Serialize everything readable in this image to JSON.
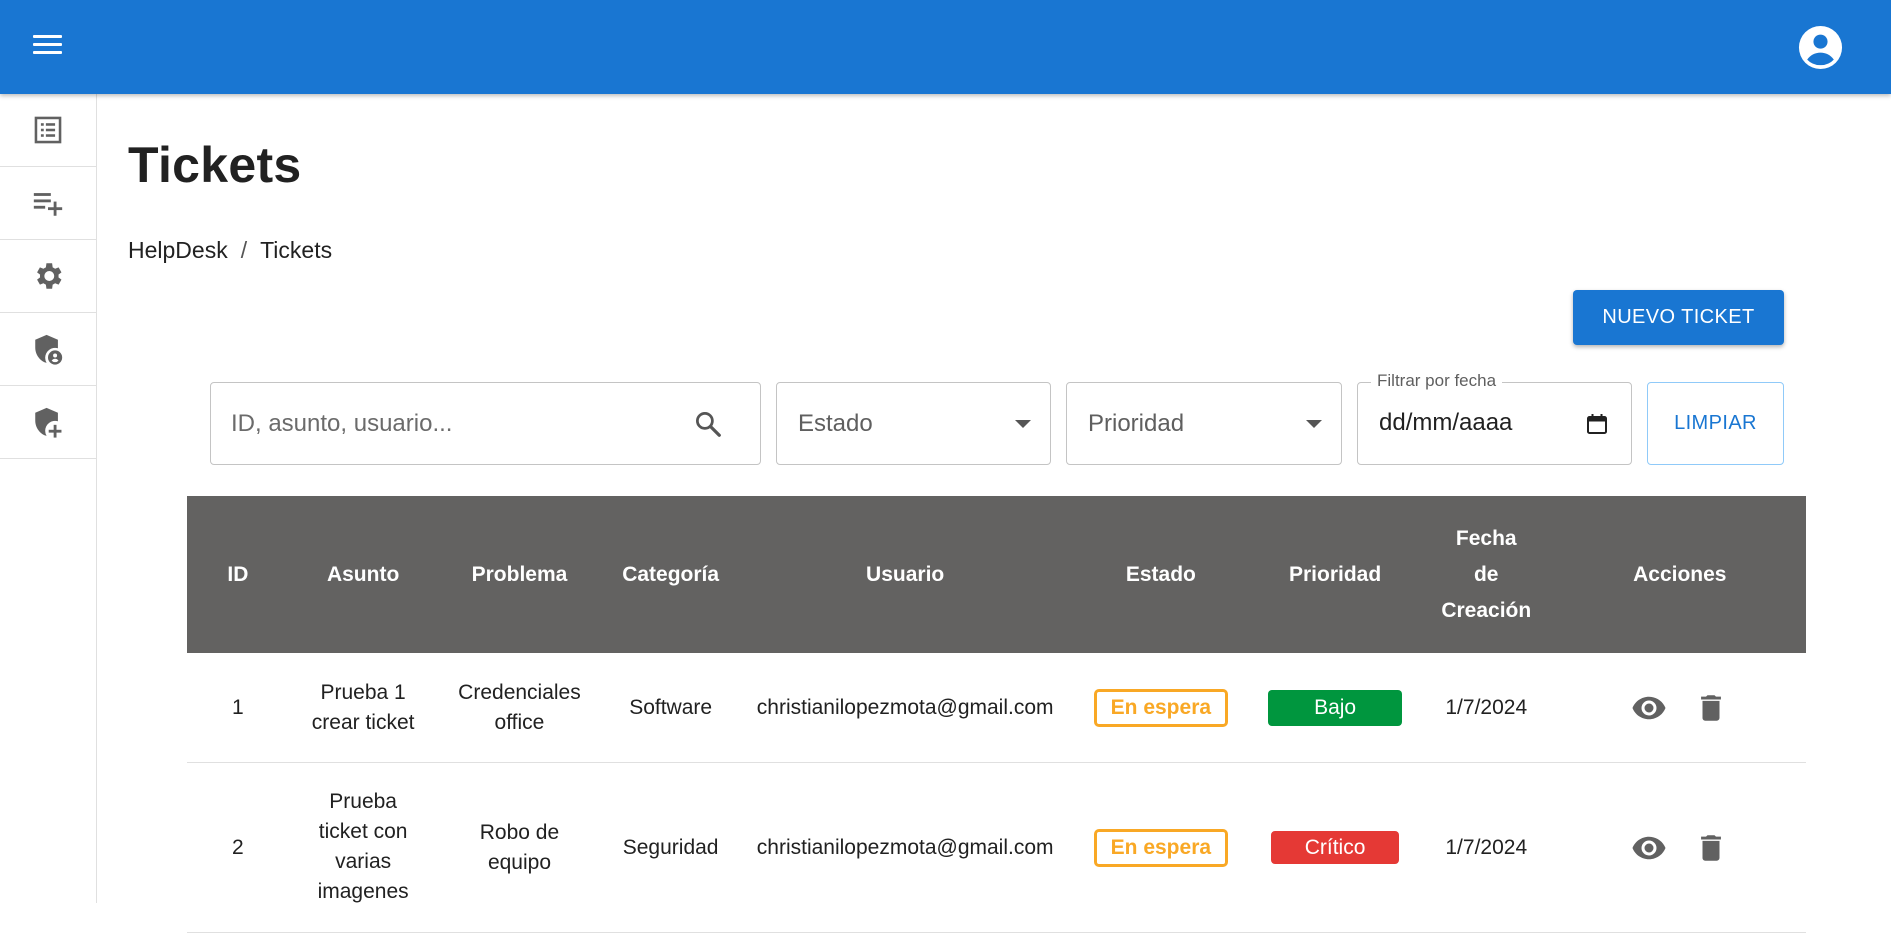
{
  "appbar": {
    "menu_icon": "menu-icon",
    "account_icon": "account-circle-icon",
    "color": "#1976d2"
  },
  "sidebar": {
    "items": [
      {
        "icon": "list-alt-icon"
      },
      {
        "icon": "playlist-add-icon"
      },
      {
        "icon": "settings-icon"
      },
      {
        "icon": "admin-panel-icon"
      },
      {
        "icon": "add-moderator-icon"
      }
    ]
  },
  "page": {
    "title": "Tickets",
    "breadcrumb": [
      "HelpDesk",
      "/",
      "Tickets"
    ],
    "new_ticket_label": "NUEVO TICKET"
  },
  "filters": {
    "search_placeholder": "ID, asunto, usuario...",
    "estado_label": "Estado",
    "prioridad_label": "Prioridad",
    "date_label": "Filtrar por fecha",
    "date_value": "dd/mm/aaaa",
    "clear_label": "LIMPIAR"
  },
  "table": {
    "headers": {
      "id": "ID",
      "asunto": "Asunto",
      "problema": "Problema",
      "categoria": "Categoría",
      "usuario": "Usuario",
      "estado": "Estado",
      "prioridad": "Prioridad",
      "fecha_1": "Fecha",
      "fecha_2": "de",
      "fecha_3": "Creación",
      "acciones": "Acciones"
    },
    "rows": [
      {
        "id": "1",
        "asunto_1": "Prueba 1",
        "asunto_2": "crear ticket",
        "problema_1": "Credenciales",
        "problema_2": "office",
        "categoria": "Software",
        "usuario": "christianilopezmota@gmail.com",
        "estado": "En espera",
        "prioridad": "Bajo",
        "fecha": "1/7/2024"
      },
      {
        "id": "2",
        "asunto_1": "Prueba",
        "asunto_2": "ticket con",
        "asunto_3": "varias",
        "asunto_4": "imagenes",
        "problema_1": "Robo de",
        "problema_2": "equipo",
        "categoria": "Seguridad",
        "usuario": "christianilopezmota@gmail.com",
        "estado": "En espera",
        "prioridad": "Crítico",
        "fecha": "1/7/2024"
      }
    ]
  },
  "colors": {
    "estado_en_espera": "#f9a825",
    "prioridad_bajo": "#00963e",
    "prioridad_critico": "#e53935",
    "table_header": "#636261"
  }
}
